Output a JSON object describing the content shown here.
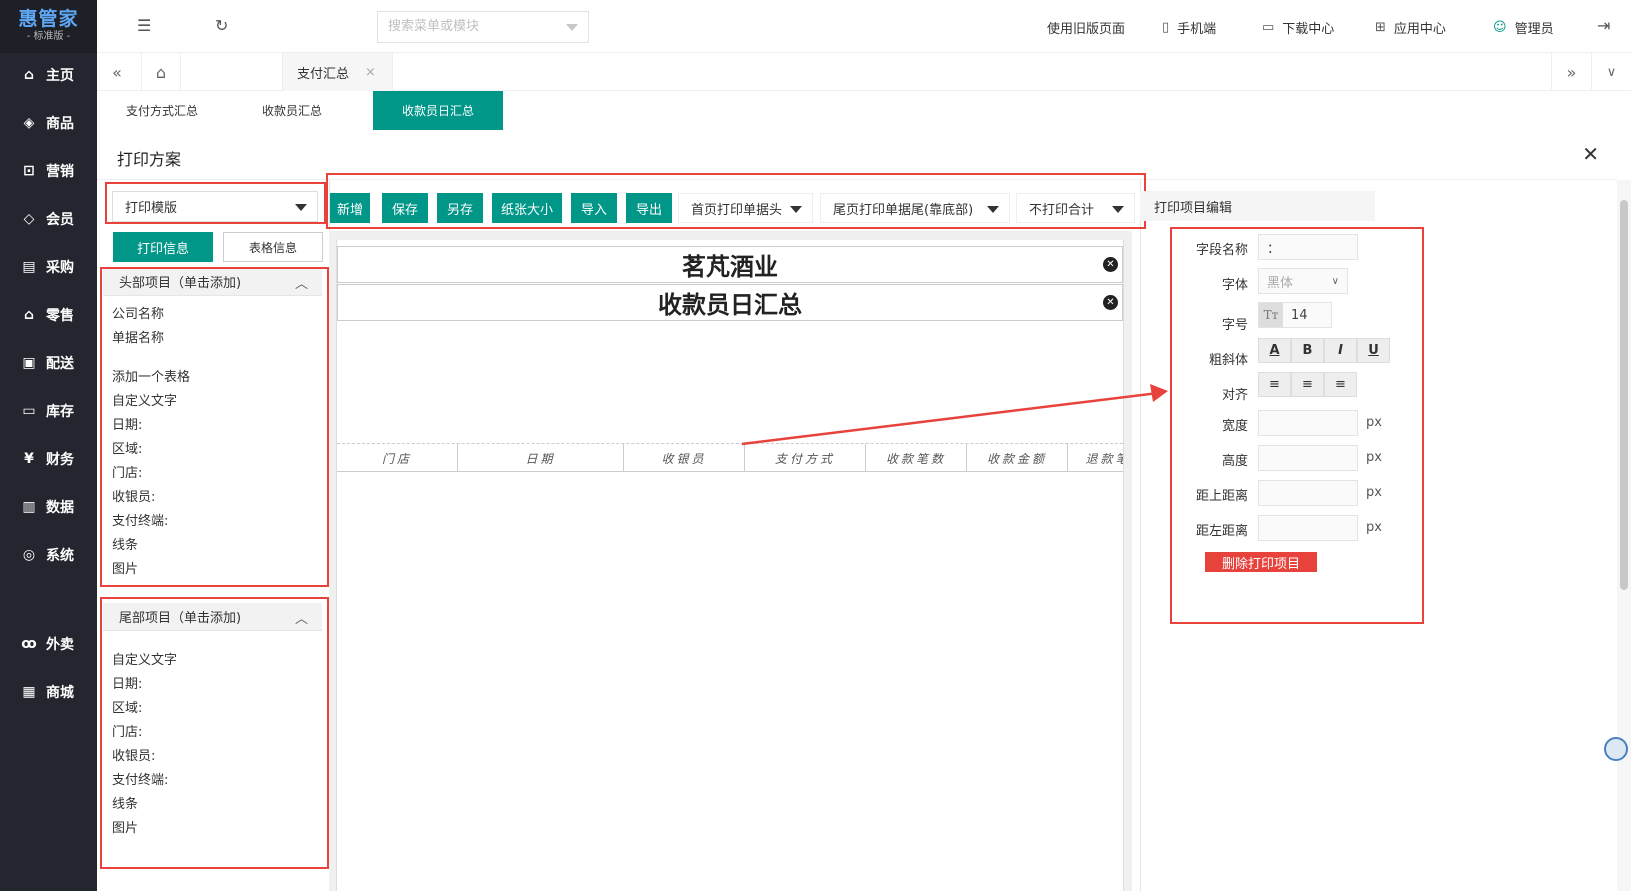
{
  "sidebar": {
    "logo_title": "惠管家",
    "logo_sub": "- 标准版 -",
    "items": [
      {
        "label": "主页",
        "icon": "home-icon"
      },
      {
        "label": "商品",
        "icon": "cube-icon"
      },
      {
        "label": "营销",
        "icon": "chart-line-icon"
      },
      {
        "label": "会员",
        "icon": "diamond-icon"
      },
      {
        "label": "采购",
        "icon": "purchase-icon"
      },
      {
        "label": "零售",
        "icon": "bag-icon"
      },
      {
        "label": "配送",
        "icon": "truck-icon"
      },
      {
        "label": "库存",
        "icon": "box-icon"
      },
      {
        "label": "财务",
        "icon": "yen-icon"
      },
      {
        "label": "数据",
        "icon": "bar-chart-icon"
      },
      {
        "label": "系统",
        "icon": "settings-icon"
      },
      {
        "label": "外卖",
        "icon": "bike-icon"
      },
      {
        "label": "商城",
        "icon": "store-icon"
      }
    ]
  },
  "topbar": {
    "search_placeholder": "搜索菜单或模块",
    "old_version": "使用旧版页面",
    "mobile": "手机端",
    "download": "下载中心",
    "apps": "应用中心",
    "user": "管理员"
  },
  "tabs": {
    "active_tab": "支付汇总"
  },
  "subtabs": [
    "支付方式汇总",
    "收款员汇总",
    "收款员日汇总"
  ],
  "panel": {
    "title": "打印方案",
    "template_select": "打印模版",
    "btn_print_info": "打印信息",
    "btn_table_info": "表格信息"
  },
  "toolbar": {
    "new": "新增",
    "save": "保存",
    "save_as": "另存",
    "paper_size": "纸张大小",
    "import": "导入",
    "export": "导出",
    "first_page_header": "首页打印单据头",
    "last_page_footer": "尾页打印单据尾(靠底部)",
    "no_total": "不打印合计"
  },
  "header_section": {
    "title": "头部项目（单击添加)",
    "items": [
      "公司名称",
      "单据名称",
      "添加一个表格",
      "自定义文字",
      "日期:",
      "区域:",
      "门店:",
      "收银员:",
      "支付终端:",
      "线条",
      "图片"
    ]
  },
  "footer_section": {
    "title": "尾部项目（单击添加)",
    "items": [
      "自定义文字",
      "日期:",
      "区域:",
      "门店:",
      "收银员:",
      "支付终端:",
      "线条",
      "图片"
    ]
  },
  "canvas": {
    "company": "茗芃酒业",
    "doc_title": "收款员日汇总",
    "columns": [
      "门店",
      "日期",
      "收银员",
      "支付方式",
      "收款笔数",
      "收款金额",
      "退款笔"
    ]
  },
  "editor": {
    "title": "打印项目编辑",
    "field_name_label": "字段名称",
    "field_name_value": "：",
    "font_label": "字体",
    "font_value": "黑体",
    "size_label": "字号",
    "size_value": "14",
    "style_label": "粗斜体",
    "align_label": "对齐",
    "width_label": "宽度",
    "height_label": "高度",
    "top_label": "距上距离",
    "left_label": "距左距离",
    "unit": "px",
    "delete_button": "删除打印项目",
    "format_buttons": [
      "A",
      "B",
      "I",
      "U"
    ]
  },
  "colors": {
    "accent": "#009688",
    "highlight_red": "#e8423c",
    "sidebar_bg": "#23262e"
  }
}
